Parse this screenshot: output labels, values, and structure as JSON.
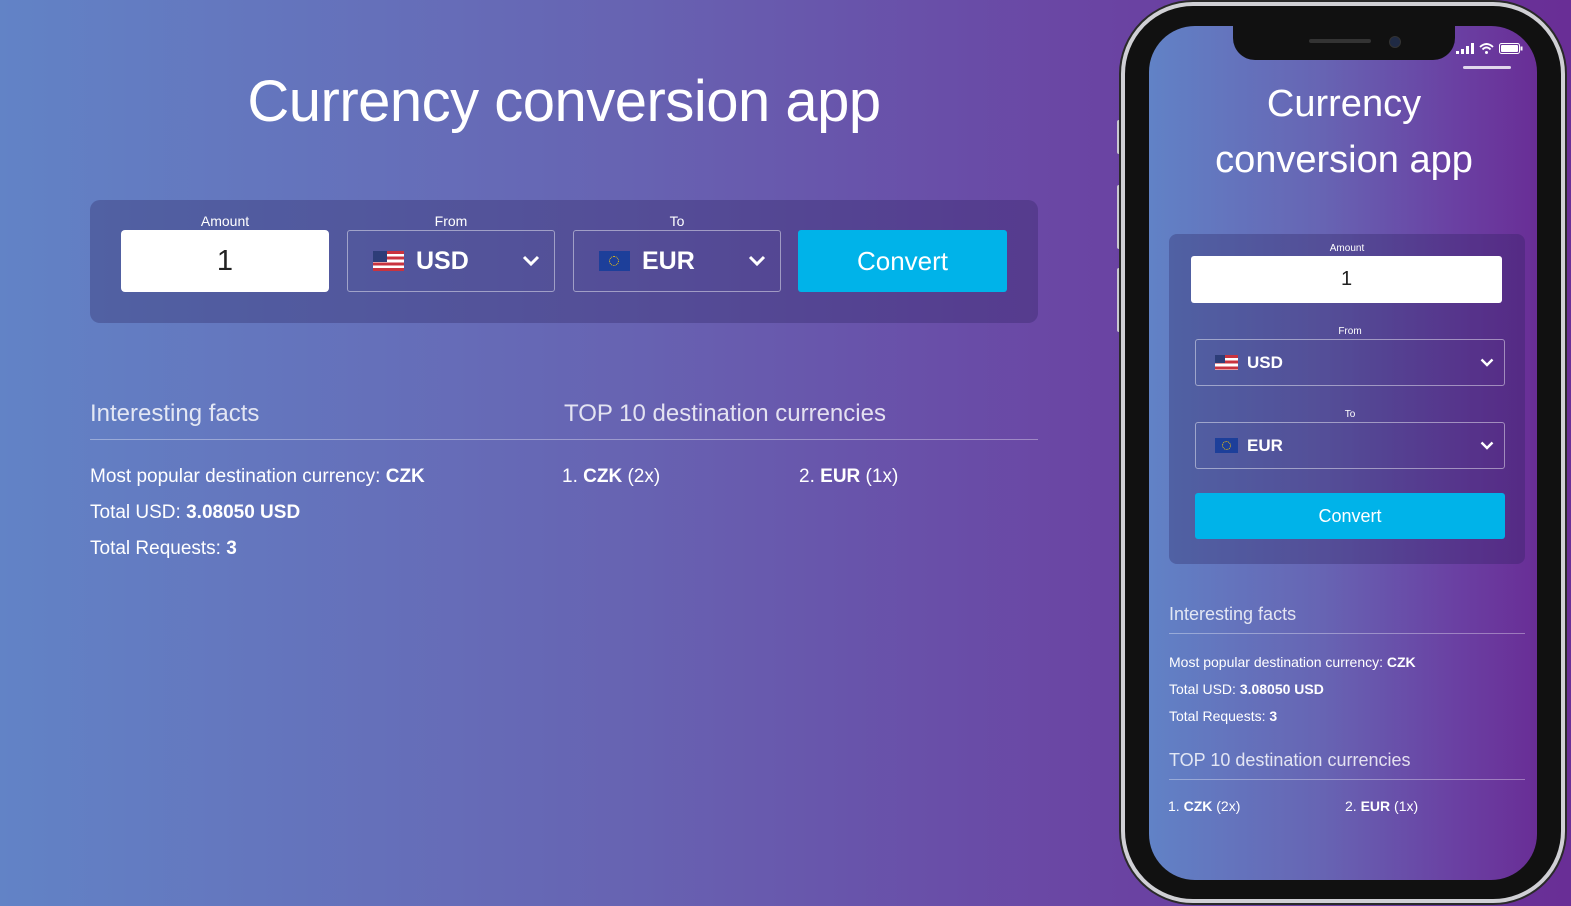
{
  "app": {
    "title": "Currency conversion app"
  },
  "form": {
    "amount_label": "Amount",
    "amount_value": "1",
    "from_label": "From",
    "from_value": "USD",
    "to_label": "To",
    "to_value": "EUR",
    "convert_label": "Convert"
  },
  "facts": {
    "heading": "Interesting facts",
    "popular_label": "Most popular destination currency: ",
    "popular_value": "CZK",
    "total_usd_label": "Total USD: ",
    "total_usd_value": "3.08050 USD",
    "total_requests_label": "Total Requests: ",
    "total_requests_value": "3"
  },
  "top10": {
    "heading": "TOP 10 destination currencies",
    "items": [
      {
        "rank": "1.",
        "code": "CZK",
        "count": "(2x)"
      },
      {
        "rank": "2.",
        "code": "EUR",
        "count": "(1x)"
      }
    ]
  },
  "colors": {
    "accent": "#00b3e9",
    "gradient_start": "#6283c6",
    "gradient_end": "#692e96"
  }
}
